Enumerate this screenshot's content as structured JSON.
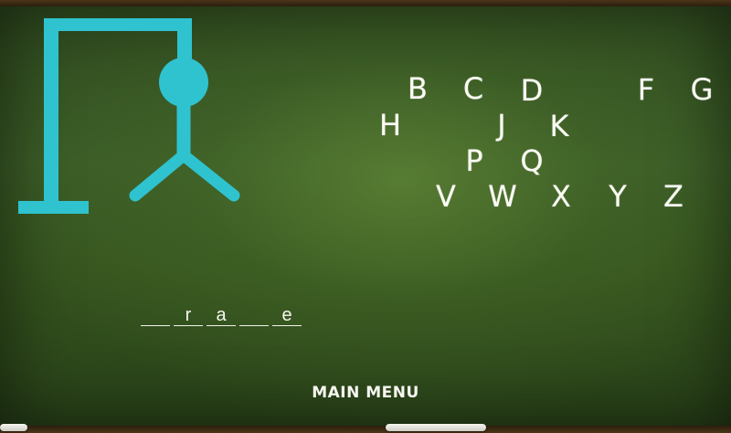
{
  "game": {
    "word_slots": [
      "",
      "r",
      "a",
      "",
      "e"
    ],
    "available_letters": [
      "B",
      "C",
      "D",
      "F",
      "G",
      "H",
      "J",
      "K",
      "P",
      "Q",
      "V",
      "W",
      "X",
      "Y",
      "Z"
    ],
    "main_menu_label": "MAIN MENU"
  },
  "colors": {
    "chalk_cyan": "#2fc3cf",
    "chalk_white": "#fbfbf4",
    "board_green": "#3b5c27"
  }
}
